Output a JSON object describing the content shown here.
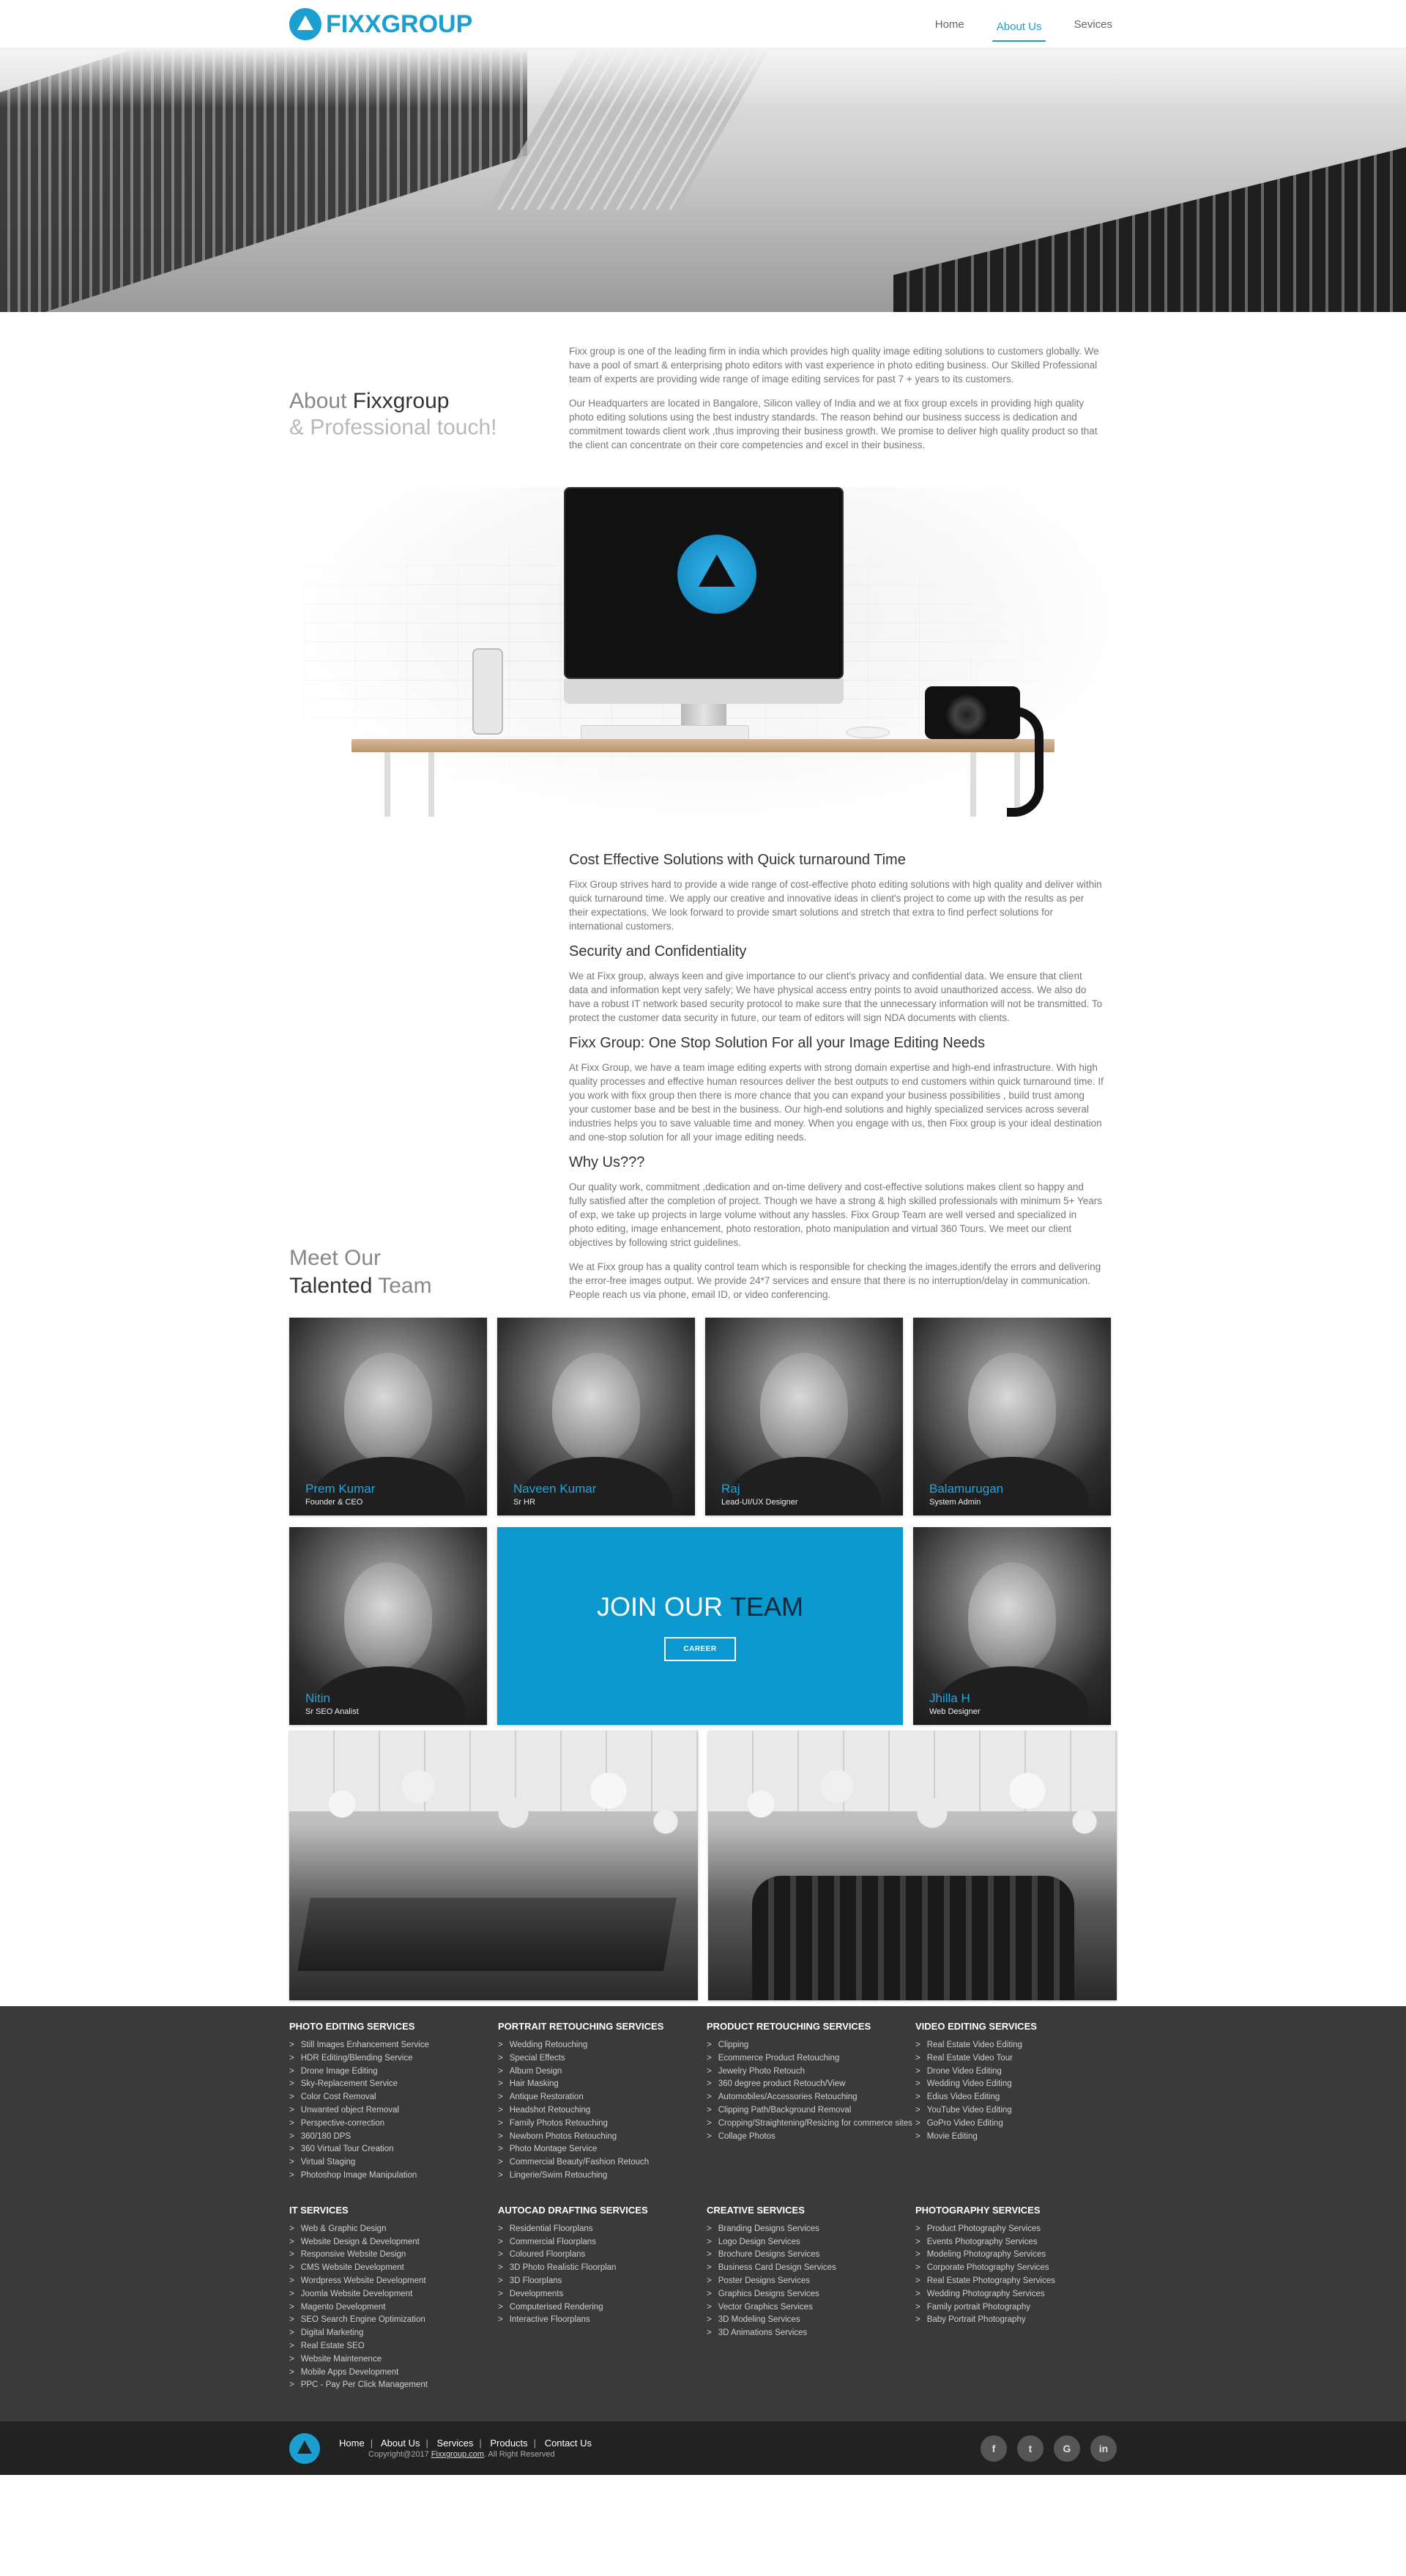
{
  "brand": {
    "name": "FIXXGROUP",
    "accent": "#1a9fd0"
  },
  "nav": [
    {
      "label": "Home"
    },
    {
      "label": "About Us"
    },
    {
      "label": "Sevices"
    }
  ],
  "about": {
    "title_line1_a": "About ",
    "title_line1_b": "Fixxgroup",
    "title_line2": "& Professional touch!",
    "paragraphs": [
      "Fixx group is one of the leading firm in india which provides high quality image editing solutions to customers globally. We have a pool of smart & enterprising photo editors with vast experience in photo editing business. Our Skilled Professional team of experts are providing wide range of image editing services for past 7 + years to its customers.",
      "Our Headquarters are located in Bangalore, Silicon valley of India and we at fixx group excels in providing high quality photo editing solutions using the best industry standards. The reason behind our business success is dedication and commitment towards client work ,thus improving their business growth. We promise to deliver high quality product so that the client can concentrate on their core competencies and excel in their business."
    ]
  },
  "solutions": [
    {
      "heading": "Cost Effective Solutions with Quick turnaround Time",
      "body": "Fixx Group strives hard to provide a wide range of cost-effective photo editing solutions with high quality and deliver within quick turnaround time. We apply our creative and innovative ideas in client's project to come up with the results as per their expectations. We look forward to provide smart solutions and stretch that extra to find perfect solutions for international customers."
    },
    {
      "heading": "Security and Confidentiality",
      "body": "We at Fixx group, always keen and give importance to our client's privacy and confidential data. We ensure that client data and information kept very safely; We have physical access entry points to avoid unauthorized access. We also do have a robust IT network based security protocol to make sure that the unnecessary information will not be transmitted. To protect the customer data security in future, our team of editors will sign NDA documents with clients."
    },
    {
      "heading": "Fixx Group: One Stop Solution For all your Image Editing Needs",
      "body": "At Fixx Group, we have a team image editing experts with strong domain expertise and high-end infrastructure. With high quality processes and effective human resources deliver the best outputs to end customers within quick turnaround time. If you work with fixx group then there is more chance that you can expand your business possibilities , build trust among your customer base and be best in the business. Our high-end solutions and highly specialized services across several industries helps you to save valuable time and money. When you engage with us, then Fixx group is your ideal destination and one-stop solution for all your image editing needs."
    },
    {
      "heading": "Why Us???",
      "body": "Our quality work, commitment ,dedication and on-time delivery and cost-effective solutions makes client so happy and fully satisfied after the completion of project. Though we have a strong & high skilled professionals with minimum 5+ Years of exp, we take up projects in large volume without any hassles. Fixx Group Team are well versed and specialized in photo editing, image enhancement, photo restoration, photo manipulation and virtual 360 Tours. We meet our client objectives by following strict guidelines.",
      "body2": "We at Fixx group has a quality control team which is responsible for checking the images,identify the errors and delivering the error-free images output. We provide 24*7 services and ensure that there is no interruption/delay in communication. People reach us via phone, email ID, or video conferencing."
    }
  ],
  "team": {
    "title_line1": "Meet Our",
    "title_line2_a": "Talented",
    "title_line2_b": " Team",
    "members": [
      {
        "name": "Prem Kumar",
        "role": "Founder & CEO"
      },
      {
        "name": "Naveen Kumar",
        "role": "Sr HR"
      },
      {
        "name": "Raj",
        "role": "Lead-UI/UX Designer"
      },
      {
        "name": "Balamurugan",
        "role": "System Admin"
      },
      {
        "name": "Nitin",
        "role": "Sr SEO Analist"
      },
      {
        "name": "Jhilla H",
        "role": "Web Designer"
      }
    ],
    "join_a": "JOIN OUR ",
    "join_b": "TEAM",
    "career": "CAREER"
  },
  "footer_columns": [
    {
      "title": "PHOTO EDITING SERVICES",
      "items": [
        "Still Images Enhancement Service",
        "HDR Editing/Blending Service",
        "Drone Image Editing",
        "Sky-Replacement Service",
        "Color Cost Removal",
        "Unwanted object Removal",
        "Perspective-correction",
        "360/180 DPS",
        "360 Virtual Tour Creation",
        "Virtual Staging",
        "Photoshop Image Manipulation"
      ]
    },
    {
      "title": "PORTRAIT RETOUCHING SERVICES",
      "items": [
        "Wedding Retouching",
        "Special Effects",
        "Album Design",
        "Hair Masking",
        "Antique Restoration",
        "Headshot Retouching",
        "Family Photos Retouching",
        "Newborn Photos Retouching",
        "Photo Montage Service",
        "Commercial Beauty/Fashion Retouch",
        "Lingerie/Swim Retouching"
      ]
    },
    {
      "title": "PRODUCT RETOUCHING SERVICES",
      "items": [
        "Clipping",
        "Ecommerce Product Retouching",
        "Jewelry Photo Retouch",
        "360 degree product Retouch/View",
        "Automobiles/Accessories Retouching",
        "Clipping Path/Background Removal",
        "Cropping/Straightening/Resizing for commerce sites",
        "Collage Photos"
      ]
    },
    {
      "title": "VIDEO EDITING SERVICES",
      "items": [
        "Real Estate Video Editing",
        "Real Estate Video Tour",
        "Drone Video Editing",
        "Wedding Video Editing",
        "Edius Video Editing",
        "YouTube Video Editing",
        "GoPro Video Editing",
        "Movie Editing"
      ]
    },
    {
      "title": "IT SERVICES",
      "items": [
        "Web & Graphic Design",
        "Website Design & Development",
        "Responsive Website Design",
        "CMS Website Development",
        "Wordpress Website Development",
        "Joomla Website Development",
        "Magento Development",
        "SEO Search Engine Optimization",
        "Digital Marketing",
        "Real Estate SEO",
        "Website Maintenence",
        "Mobile Apps Development",
        "PPC - Pay Per Click Management"
      ]
    },
    {
      "title": "AUTOCAD DRAFTING SERVICES",
      "items": [
        "Residential Floorplans",
        "Commercial Floorplans",
        "Coloured Floorplans",
        "3D Photo Realistic Floorplan",
        "3D Floorplans",
        "Developments",
        "Computerised Rendering",
        "Interactive Floorplans"
      ]
    },
    {
      "title": "CREATIVE SERVICES",
      "items": [
        "Branding Designs Services",
        "Logo Design Services",
        "Brochure Designs Services",
        "Business Card Design Services",
        "Poster Designs Services",
        "Graphics Designs Services",
        "Vector Graphics Services",
        "3D Modeling Services",
        "3D Animations Services"
      ]
    },
    {
      "title": "PHOTOGRAPHY SERVICES",
      "items": [
        "Product Photography Services",
        "Events Photography Services",
        "Modeling Photography Services",
        "Corporate Photography Services",
        "Real Estate Photography Services",
        "Wedding Photography Services",
        "Family portrait Photography",
        "Baby Portrait Photography"
      ]
    }
  ],
  "bottom": {
    "links": [
      "Home",
      "About Us",
      "Services",
      "Products",
      "Contact Us"
    ],
    "copy_a": "Copyright@2017 ",
    "copy_link": "Fixxgroup.com",
    "copy_b": ". All Right Reserved",
    "social": [
      {
        "icon": "facebook-icon",
        "glyph": "f"
      },
      {
        "icon": "twitter-icon",
        "glyph": "t"
      },
      {
        "icon": "google-plus-icon",
        "glyph": "G"
      },
      {
        "icon": "linkedin-icon",
        "glyph": "in"
      }
    ]
  }
}
